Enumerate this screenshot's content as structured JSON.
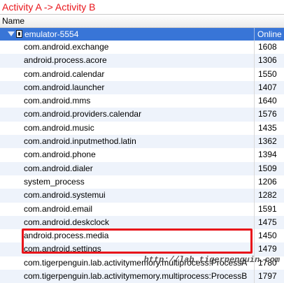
{
  "caption": "Activity A -> Activity B",
  "columns": {
    "name": "Name"
  },
  "device": {
    "name": "emulator-5554",
    "status": "Online"
  },
  "processes": [
    {
      "name": "com.android.exchange",
      "pid": "1608"
    },
    {
      "name": "android.process.acore",
      "pid": "1306"
    },
    {
      "name": "com.android.calendar",
      "pid": "1550"
    },
    {
      "name": "com.android.launcher",
      "pid": "1407"
    },
    {
      "name": "com.android.mms",
      "pid": "1640"
    },
    {
      "name": "com.android.providers.calendar",
      "pid": "1576"
    },
    {
      "name": "com.android.music",
      "pid": "1435"
    },
    {
      "name": "com.android.inputmethod.latin",
      "pid": "1362"
    },
    {
      "name": "com.android.phone",
      "pid": "1394"
    },
    {
      "name": "com.android.dialer",
      "pid": "1509"
    },
    {
      "name": "system_process",
      "pid": "1206"
    },
    {
      "name": "com.android.systemui",
      "pid": "1282"
    },
    {
      "name": "com.android.email",
      "pid": "1591"
    },
    {
      "name": "com.android.deskclock",
      "pid": "1475"
    },
    {
      "name": "android.process.media",
      "pid": "1450"
    },
    {
      "name": "com.android.settings",
      "pid": "1479"
    },
    {
      "name": "com.tigerpenguin.lab.activitymemory.multiprocess:ProcessA",
      "pid": "1780"
    },
    {
      "name": "com.tigerpenguin.lab.activitymemory.multiprocess:ProcessB",
      "pid": "1797"
    }
  ],
  "watermark": "http://lab.tigerpenguin.com",
  "colors": {
    "selection": "#3875d7",
    "highlight_border": "#e8141a",
    "caption": "#e8141a"
  }
}
